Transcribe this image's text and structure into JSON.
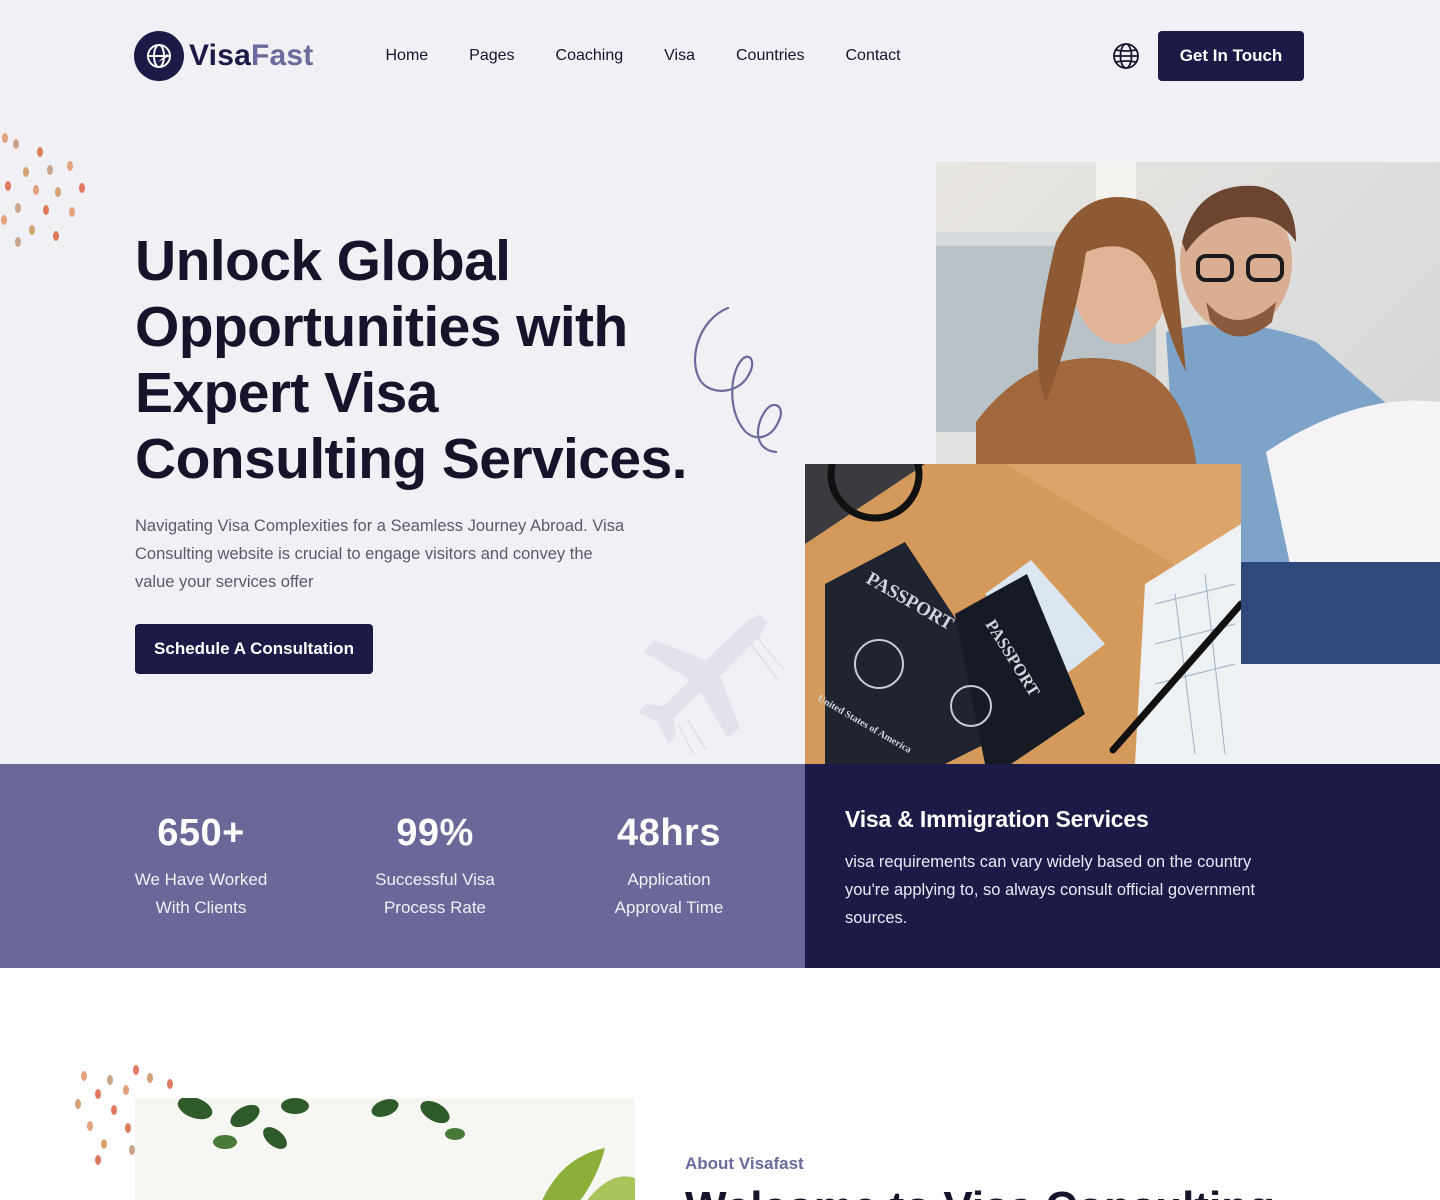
{
  "brand": {
    "name_part1": "Visa",
    "name_part2": "Fast",
    "primary_color": "#1c1a46",
    "secondary_color": "#696898"
  },
  "nav": {
    "items": [
      "Home",
      "Pages",
      "Coaching",
      "Visa",
      "Countries",
      "Contact"
    ],
    "language_icon": "globe-icon",
    "cta_label": "Get In Touch"
  },
  "hero": {
    "title": "Unlock Global Opportunities with Expert Visa Consulting Services.",
    "description": "Navigating Visa Complexities for a Seamless Journey Abroad. Visa Consulting website is crucial to engage visitors and convey the value your services offer",
    "cta_label": "Schedule A Consultation",
    "passport_text_1": "PASSPORT",
    "passport_text_2": "PASSPORT",
    "passport_country": "United States of America"
  },
  "stats": [
    {
      "value": "650+",
      "label_line1": "We Have Worked",
      "label_line2": "With Clients"
    },
    {
      "value": "99%",
      "label_line1": "Successful Visa",
      "label_line2": "Process Rate"
    },
    {
      "value": "48hrs",
      "label_line1": "Application",
      "label_line2": "Approval Time"
    }
  ],
  "services": {
    "title": "Visa & Immigration Services",
    "description": "visa requirements can vary widely based on the country you're applying to, so always consult official government sources."
  },
  "about": {
    "label": "About Visafast",
    "title_partial": "Welcome to Visa Consulting"
  }
}
